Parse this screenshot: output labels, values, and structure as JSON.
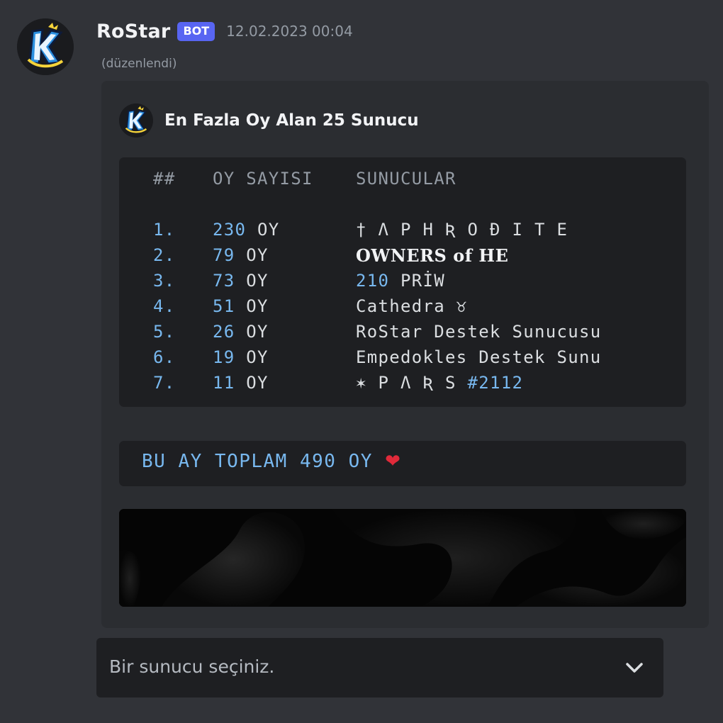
{
  "message": {
    "author": "RoStar",
    "bot_tag": "BOT",
    "timestamp": "12.02.2023 00:04",
    "edited": "(düzenlendi)",
    "avatar_icon": "rostar-k-logo-icon"
  },
  "embed": {
    "title": "En Fazla Oy Alan 25 Sunucu",
    "table": {
      "header": {
        "num": "##",
        "votes": "OY SAYISI",
        "servers": "SUNUCULAR"
      },
      "rows": [
        {
          "num": "1.",
          "votes": "230",
          "unit": "OY",
          "server": "† Λ P H Ʀ O Đ I T E"
        },
        {
          "num": "2.",
          "votes": "79",
          "unit": "OY",
          "server": "OWNERS of HE"
        },
        {
          "num": "3.",
          "votes": "73",
          "unit": "OY",
          "server_num": "210",
          "server": "PRİW"
        },
        {
          "num": "4.",
          "votes": "51",
          "unit": "OY",
          "server": "Cathedra ♉"
        },
        {
          "num": "5.",
          "votes": "26",
          "unit": "OY",
          "server": "RoStar Destek Sunucusu"
        },
        {
          "num": "6.",
          "votes": "19",
          "unit": "OY",
          "server": "Empedokles Destek Sunu"
        },
        {
          "num": "7.",
          "votes": "11",
          "unit": "OY",
          "server": "✶ P Λ Ʀ S",
          "server_tag": "#2112"
        }
      ]
    },
    "total": "BU AY TOPLAM 490 OY",
    "total_emoji": "❤"
  },
  "select": {
    "placeholder": "Bir sunucu seçiniz.",
    "icon": "chevron-down-icon"
  },
  "colors": {
    "background": "#313338",
    "embed": "#2b2d31",
    "code": "#1e1f22",
    "accent_blue": "#78b8ef",
    "bot_tag": "#5865f2"
  }
}
